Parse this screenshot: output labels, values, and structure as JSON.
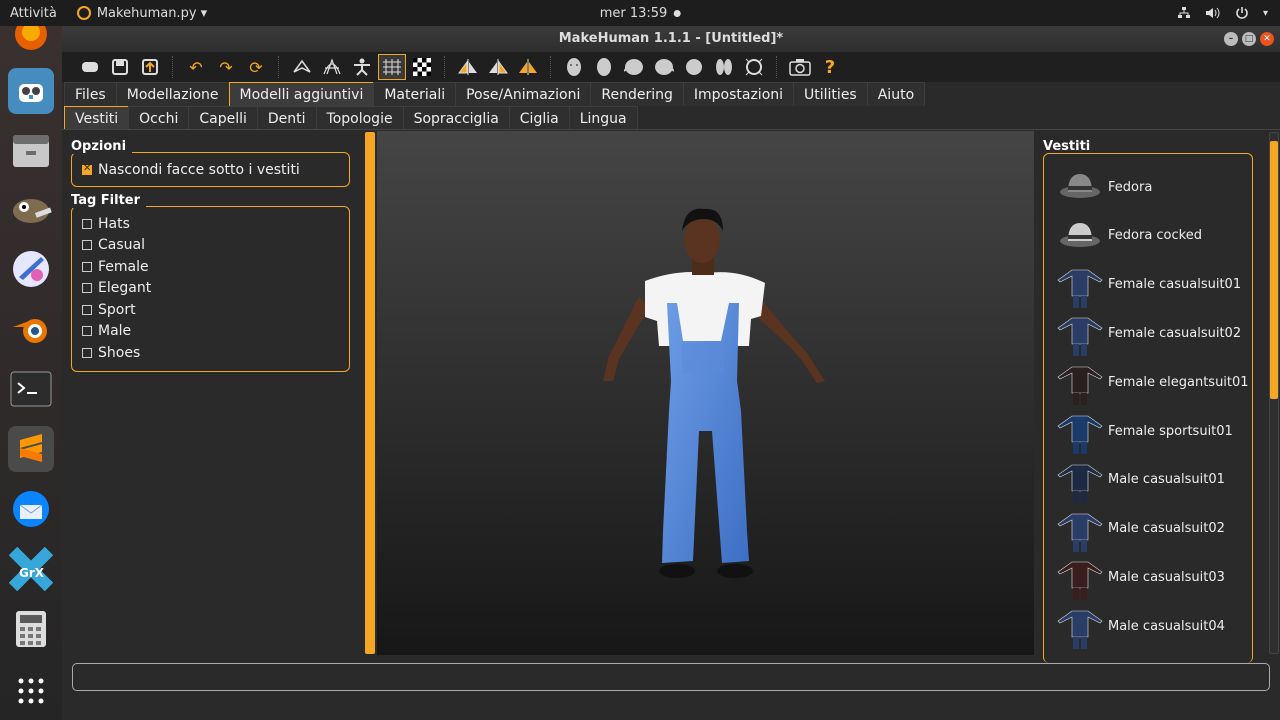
{
  "topbar": {
    "activities": "Attività",
    "app_menu": "Makehuman.py ▾",
    "clock": "mer 13:59",
    "tray_icons": [
      "network-icon",
      "volume-icon",
      "power-icon",
      "chevron-down-icon"
    ]
  },
  "dock": {
    "items": [
      "firefox",
      "godot",
      "files",
      "gimp",
      "krita",
      "blender",
      "terminal",
      "sublime-text",
      "thunderbird",
      "grafx2",
      "calculator",
      "show-apps"
    ]
  },
  "window": {
    "title": "MakeHuman 1.1.1 - [Untitled]*"
  },
  "toolbar": {
    "icons": [
      "undo-icon",
      "redo-icon",
      "reset-icon"
    ]
  },
  "main_tabs": [
    "Files",
    "Modellazione",
    "Modelli aggiuntivi",
    "Materiali",
    "Pose/Animazioni",
    "Rendering",
    "Impostazioni",
    "Utilities",
    "Aiuto"
  ],
  "main_tab_active": 2,
  "sub_tabs": [
    "Vestiti",
    "Occhi",
    "Capelli",
    "Denti",
    "Topologie",
    "Sopracciglia",
    "Ciglia",
    "Lingua"
  ],
  "sub_tab_active": 0,
  "left": {
    "options_title": "Opzioni",
    "hide_faces_label": "Nascondi facce sotto i vestiti",
    "hide_faces_checked": true,
    "tag_filter_title": "Tag Filter",
    "tags": [
      "Hats",
      "Casual",
      "Female",
      "Elegant",
      "Sport",
      "Male",
      "Shoes"
    ]
  },
  "right": {
    "title": "Vestiti",
    "items": [
      "Fedora",
      "Fedora cocked",
      "Female casualsuit01",
      "Female casualsuit02",
      "Female elegantsuit01",
      "Female sportsuit01",
      "Male casualsuit01",
      "Male casualsuit02",
      "Male casualsuit03",
      "Male casualsuit04"
    ]
  },
  "colors": {
    "accent": "#f5a623",
    "background": "#2a2a2a"
  }
}
